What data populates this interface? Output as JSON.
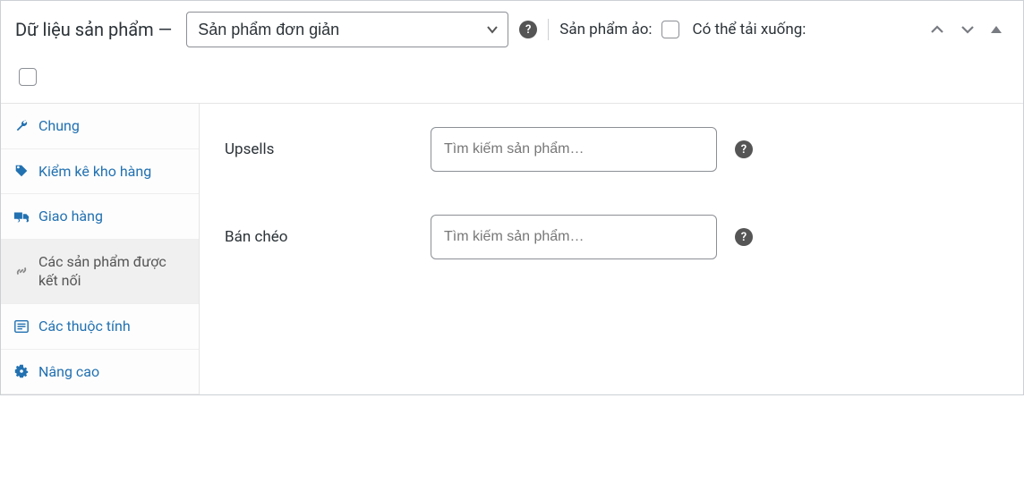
{
  "header": {
    "title": "Dữ liệu sản phẩm —",
    "product_type_selected": "Sản phẩm đơn giản",
    "virtual_label": "Sản phẩm ảo:",
    "downloadable_label": "Có thể tải xuống:"
  },
  "tabs": {
    "general": "Chung",
    "inventory": "Kiểm kê kho hàng",
    "shipping": "Giao hàng",
    "linked": "Các sản phẩm được kết nối",
    "attributes": "Các thuộc tính",
    "advanced": "Nâng cao"
  },
  "content": {
    "upsells_label": "Upsells",
    "crosssells_label": "Bán chéo",
    "search_placeholder": "Tìm kiếm sản phẩm…"
  }
}
